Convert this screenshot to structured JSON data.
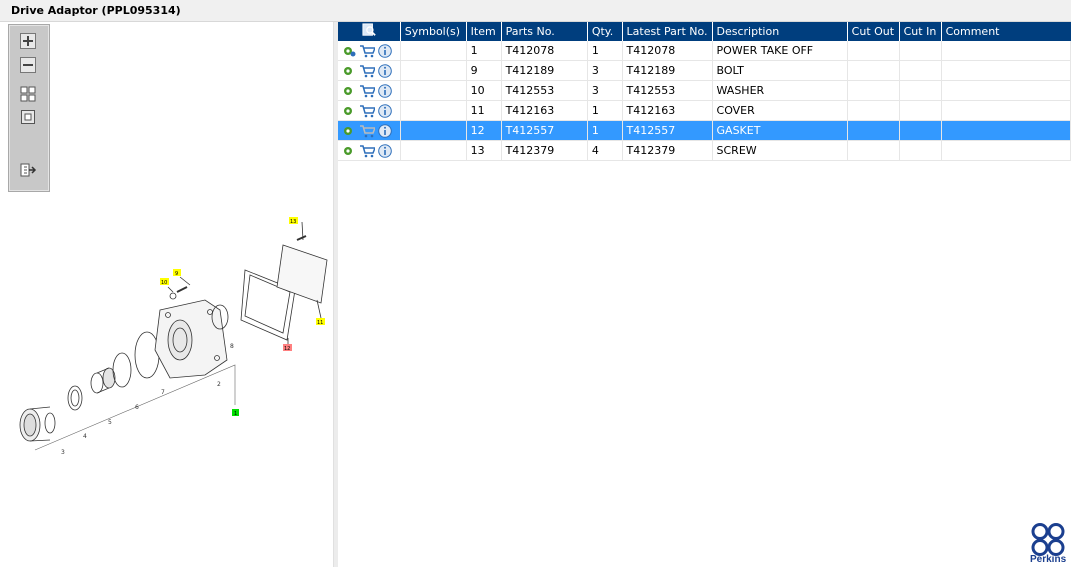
{
  "window": {
    "title": "Drive Adaptor (PPL095314)"
  },
  "toolbox": {
    "tools": [
      "zoom-in-icon",
      "zoom-out-icon",
      "fit-all-icon",
      "fit-window-icon",
      "export-icon"
    ]
  },
  "diagram": {
    "callouts": [
      {
        "label": "13",
        "color": "#ffff00"
      },
      {
        "label": "9",
        "color": "#ffff00"
      },
      {
        "label": "10",
        "color": "#ffff00"
      },
      {
        "label": "11",
        "color": "#ffff00"
      },
      {
        "label": "12",
        "color": "#ff8080"
      },
      {
        "label": "1",
        "color": "#00dd00"
      }
    ],
    "part_numbers": [
      "2",
      "3",
      "4",
      "5",
      "6",
      "7",
      "8"
    ]
  },
  "grid": {
    "columns": [
      "",
      "Symbol(s)",
      "Item",
      "Parts No.",
      "Qty.",
      "Latest Part No.",
      "Description",
      "Cut Out",
      "Cut In",
      "Comment"
    ],
    "rows": [
      {
        "item": "1",
        "part": "T412078",
        "qty": "1",
        "latest": "T412078",
        "desc": "POWER TAKE OFF",
        "symbol": "",
        "cut_out": "",
        "cut_in": "",
        "comment": ""
      },
      {
        "item": "9",
        "part": "T412189",
        "qty": "3",
        "latest": "T412189",
        "desc": "BOLT",
        "symbol": "",
        "cut_out": "",
        "cut_in": "",
        "comment": ""
      },
      {
        "item": "10",
        "part": "T412553",
        "qty": "3",
        "latest": "T412553",
        "desc": "WASHER",
        "symbol": "",
        "cut_out": "",
        "cut_in": "",
        "comment": ""
      },
      {
        "item": "11",
        "part": "T412163",
        "qty": "1",
        "latest": "T412163",
        "desc": "COVER",
        "symbol": "",
        "cut_out": "",
        "cut_in": "",
        "comment": ""
      },
      {
        "item": "12",
        "part": "T412557",
        "qty": "1",
        "latest": "T412557",
        "desc": "GASKET",
        "symbol": "",
        "cut_out": "",
        "cut_in": "",
        "comment": ""
      },
      {
        "item": "13",
        "part": "T412379",
        "qty": "4",
        "latest": "T412379",
        "desc": "SCREW",
        "symbol": "",
        "cut_out": "",
        "cut_in": "",
        "comment": ""
      }
    ],
    "selected_row": 4
  },
  "brand": {
    "name": "Perkins",
    "color": "#1b3f8f"
  },
  "colors": {
    "header": "#003e7e",
    "selected": "#3399ff"
  }
}
